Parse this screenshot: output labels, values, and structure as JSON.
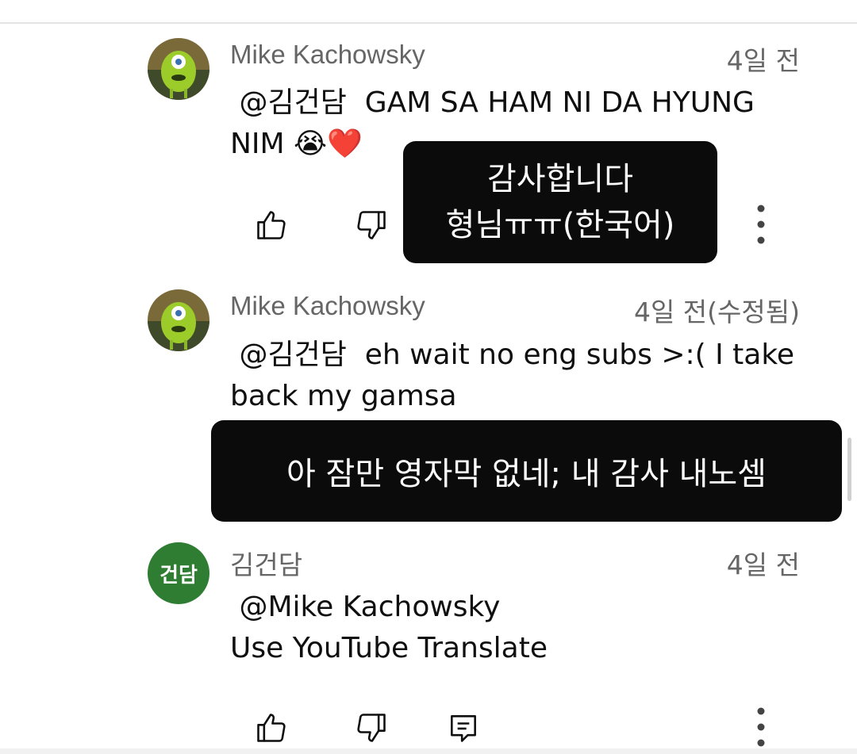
{
  "comments": [
    {
      "author": "Mike Kachowsky",
      "time": "4일 전",
      "mention": "@김건담",
      "text": " @김건담  GAM SA HAM NI DA HYUNG\nNIM 😭❤️"
    },
    {
      "author": "Mike Kachowsky",
      "time": "4일 전(수정됨)",
      "text": " @김건담  eh wait no eng subs >:( I take\nback my gamsa"
    },
    {
      "author": "김건담",
      "avatar_initials": "건담",
      "time": "4일 전",
      "text": " @Mike Kachowsky\nUse YouTube Translate"
    }
  ],
  "overlays": [
    {
      "text": "감사합니다\n형님ㅠㅠ(한국어)"
    },
    {
      "text": "아 잠만 영자막 없네; 내 감사 내노셈"
    }
  ],
  "icons": {
    "like": "thumbs-up-icon",
    "dislike": "thumbs-down-icon",
    "reply": "reply-icon",
    "more": "more-vertical-icon"
  },
  "colors": {
    "avatar_green_bg": "#2e7d32",
    "overlay_bg": "#0b0b0b",
    "meta_text": "#666666"
  }
}
